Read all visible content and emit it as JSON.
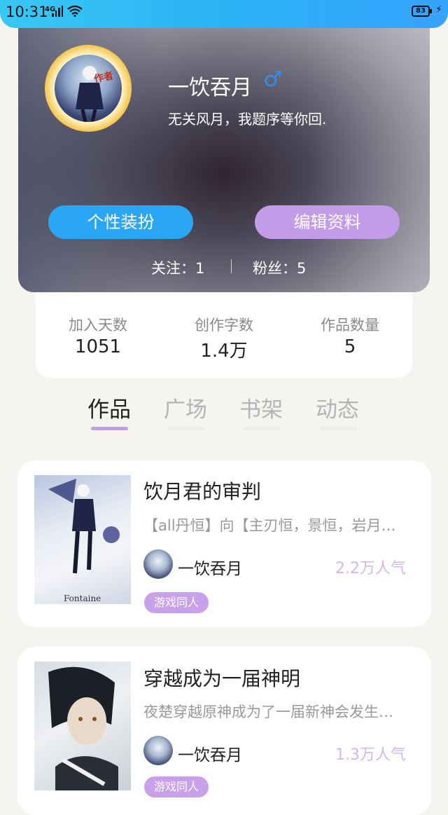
{
  "status_bar": {
    "time": "10:31",
    "network": "4G",
    "battery": "83"
  },
  "profile": {
    "nickname": "一饮吞月",
    "gender_symbol": "♂",
    "bio": "无关风月，我题序等你回.",
    "author_badge": "作者",
    "dress_button": "个性装扮",
    "edit_button": "编辑资料",
    "follow_text": "关注：1",
    "fans_text": "粉丝：5"
  },
  "stats": [
    {
      "label": "加入天数",
      "value": "1051"
    },
    {
      "label": "创作字数",
      "value": "1.4万"
    },
    {
      "label": "作品数量",
      "value": "5"
    }
  ],
  "tabs": [
    {
      "label": "作品",
      "active": true
    },
    {
      "label": "广场",
      "active": false
    },
    {
      "label": "书架",
      "active": false
    },
    {
      "label": "动态",
      "active": false
    }
  ],
  "works": [
    {
      "title": "饮月君的审判",
      "desc": "【all丹恒】向【主刃恒，景恒，岩月…",
      "author": "一饮吞月",
      "popularity": "2.2万人气",
      "tag": "游戏同人"
    },
    {
      "title": "穿越成为一届神明",
      "desc": "夜楚穿越原神成为了一届新神会发生…",
      "author": "一饮吞月",
      "popularity": "1.3万人气",
      "tag": "游戏同人"
    }
  ],
  "colors": {
    "accent_blue": "#2aa6f7",
    "accent_purple": "#c39be9"
  }
}
